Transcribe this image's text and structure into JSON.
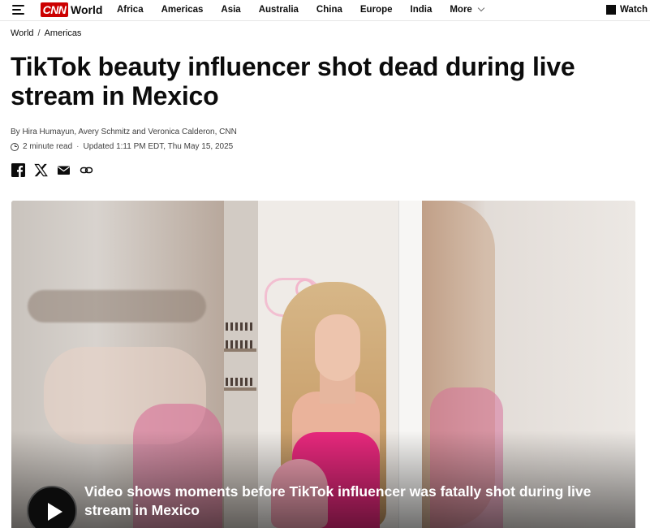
{
  "nav": {
    "logo": "CNN",
    "section": "World",
    "links": [
      "Africa",
      "Americas",
      "Asia",
      "Australia",
      "China",
      "Europe",
      "India"
    ],
    "more": "More",
    "watch": "Watch"
  },
  "breadcrumb": {
    "items": [
      "World",
      "Americas"
    ],
    "separator": "/"
  },
  "article": {
    "headline": "TikTok beauty influencer shot dead during live stream in Mexico",
    "byline": "By Hira Humayun, Avery Schmitz and Veronica Calderon, CNN",
    "read_time": "2 minute read",
    "separator": "·",
    "updated": "Updated 1:11 PM EDT, Thu May 15, 2025"
  },
  "share": {
    "icons": [
      "facebook-icon",
      "x-icon",
      "email-icon",
      "link-icon"
    ]
  },
  "video": {
    "caption": "Video shows moments before TikTok influencer was fatally shot during live stream in Mexico"
  },
  "colors": {
    "brand_red": "#cc0000",
    "text": "#0c0c0c",
    "meta_text": "#404040"
  }
}
